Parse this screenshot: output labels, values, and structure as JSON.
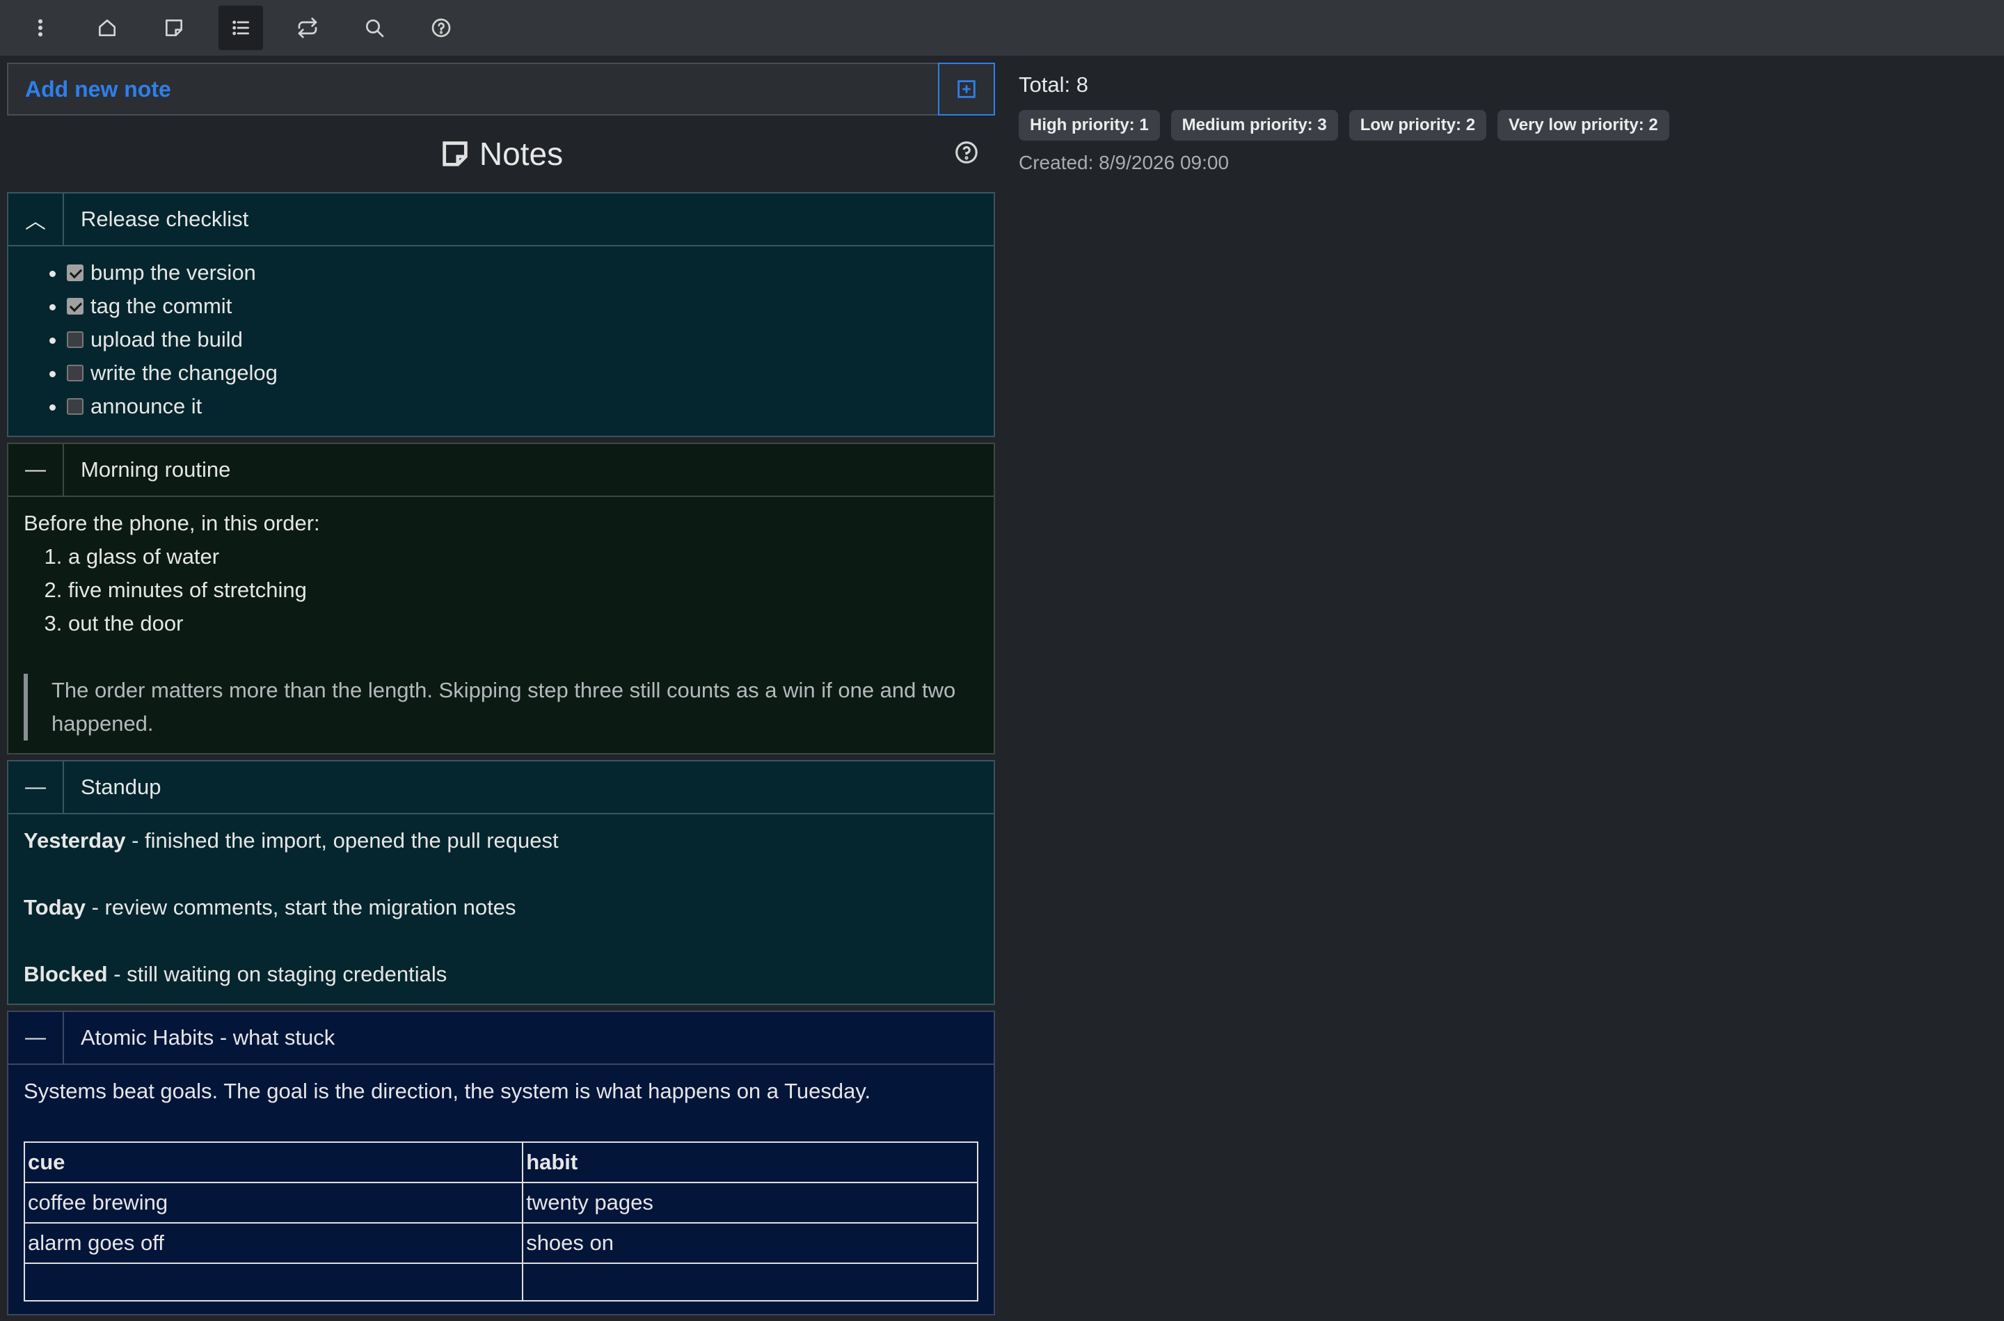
{
  "toolbar": {
    "icons": [
      "more-vertical-icon",
      "home-icon",
      "note-icon",
      "list-icon",
      "repeat-icon",
      "search-icon",
      "help-icon"
    ],
    "active": "list-icon"
  },
  "add_note": {
    "label": "Add new note"
  },
  "notes_header": {
    "title": "Notes"
  },
  "notes": {
    "release": {
      "title": "Release checklist",
      "toggle": "︿",
      "items": [
        {
          "text": "bump the version",
          "checked": true
        },
        {
          "text": "tag the commit",
          "checked": true
        },
        {
          "text": "upload the build",
          "checked": false
        },
        {
          "text": "write the changelog",
          "checked": false
        },
        {
          "text": "announce it",
          "checked": false
        }
      ]
    },
    "morning": {
      "title": "Morning routine",
      "toggle": "—",
      "intro": "Before the phone, in this order:",
      "steps": [
        "a glass of water",
        "five minutes of stretching",
        "out the door"
      ],
      "quote": "The order matters more than the length. Skipping step three still counts as a win if one and two happened."
    },
    "standup": {
      "title": "Standup",
      "toggle": "—",
      "lines": [
        {
          "label": "Yesterday",
          "text": " - finished the import, opened the pull request"
        },
        {
          "label": "Today",
          "text": " - review comments, start the migration notes"
        },
        {
          "label": "Blocked",
          "text": " - still waiting on staging credentials"
        }
      ]
    },
    "habits": {
      "title": "Atomic Habits - what stuck",
      "toggle": "—",
      "intro": "Systems beat goals. The goal is the direction, the system is what happens on a Tuesday.",
      "columns": [
        "cue",
        "habit"
      ],
      "rows": [
        [
          "coffee brewing",
          "twenty pages"
        ],
        [
          "alarm goes off",
          "shoes on"
        ]
      ]
    }
  },
  "summary": {
    "total": "Total: 8",
    "badges": [
      "High priority: 1",
      "Medium priority: 3",
      "Low priority: 2",
      "Very low priority: 2"
    ],
    "created": "Created: 8/9/2026 09:00"
  }
}
